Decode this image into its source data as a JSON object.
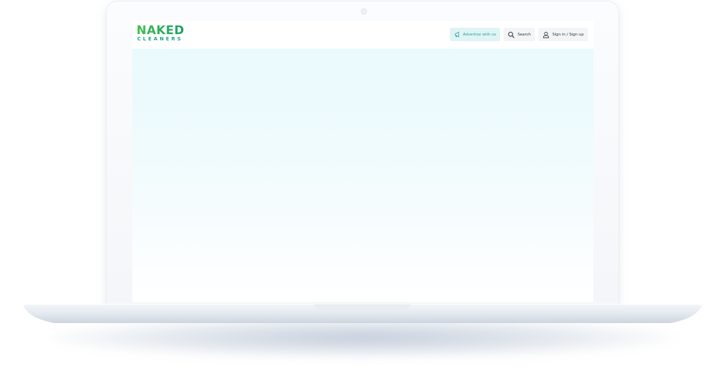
{
  "logo": {
    "top_text": "NAKED",
    "bottom_text": "CLEANERS",
    "colors": {
      "green": "#3fbf4a",
      "teal": "#19a584"
    }
  },
  "nav": {
    "advertise_label": "Advertise with us",
    "advertise_icon": "megaphone-icon",
    "search_label": "Search",
    "search_icon": "search-icon",
    "signin_label": "Sign in / Sign up",
    "signin_icon": "user-icon"
  },
  "hero": {
    "background_color": "#e9fafd"
  },
  "device": {
    "type": "laptop-mockup",
    "lid_color": "#f4f6f9",
    "base_color": "#e3e8ef"
  }
}
